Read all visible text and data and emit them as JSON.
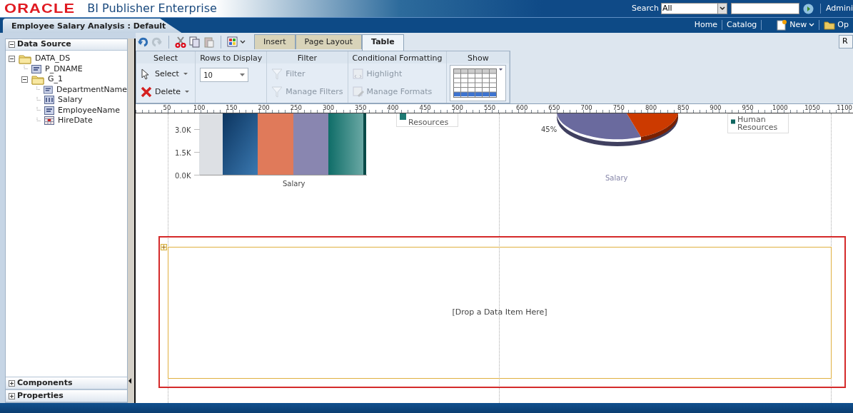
{
  "header": {
    "logo": "ORACLE",
    "product": "BI Publisher Enterprise",
    "search_label": "Search",
    "search_scope": "All",
    "user": "Admini"
  },
  "nav": {
    "report_tab": "Employee Salary Analysis : Default",
    "links": [
      {
        "label": "Home",
        "kind": "link"
      },
      {
        "label": "Catalog",
        "kind": "link"
      },
      {
        "label": "New",
        "kind": "new"
      },
      {
        "label": "Op",
        "kind": "open"
      }
    ]
  },
  "data_source": {
    "title": "Data Source",
    "expanded": true,
    "tree": [
      {
        "label": "DATA_DS",
        "kind": "folder",
        "expanded": true,
        "children": [
          {
            "label": "P_DNAME",
            "kind": "text"
          },
          {
            "label": "G_1",
            "kind": "folder",
            "expanded": true,
            "children": [
              {
                "label": "DepartmentName",
                "kind": "text"
              },
              {
                "label": "Salary",
                "kind": "number"
              },
              {
                "label": "EmployeeName",
                "kind": "text"
              },
              {
                "label": "HireDate",
                "kind": "date"
              }
            ]
          }
        ]
      }
    ]
  },
  "panels": [
    {
      "title": "Components",
      "expanded": false
    },
    {
      "title": "Properties",
      "expanded": false
    }
  ],
  "tabs": [
    {
      "label": "Insert",
      "selected": false
    },
    {
      "label": "Page Layout",
      "selected": false
    },
    {
      "label": "Table",
      "selected": true
    }
  ],
  "right_button": "R",
  "ribbon": [
    {
      "title": "Select",
      "kind": "buttons",
      "items": [
        {
          "label": "Select",
          "kind": "pointer",
          "disabled": false
        },
        {
          "label": "Delete",
          "kind": "delete",
          "disabled": false
        }
      ]
    },
    {
      "title": "Rows to Display",
      "kind": "select",
      "value": "10"
    },
    {
      "title": "Filter",
      "kind": "buttons",
      "items": [
        {
          "label": "Filter",
          "kind": "filter",
          "disabled": true
        },
        {
          "label": "Manage Filters",
          "kind": "filter",
          "disabled": true
        }
      ]
    },
    {
      "title": "Conditional Formatting",
      "kind": "buttons",
      "items": [
        {
          "label": "Highlight",
          "kind": "highlight",
          "disabled": true
        },
        {
          "label": "Manage Formats",
          "kind": "formats",
          "disabled": true
        }
      ]
    },
    {
      "title": "Show",
      "kind": "gallery"
    }
  ],
  "ruler": [
    "50",
    "100",
    "150",
    "200",
    "250",
    "300",
    "350",
    "400",
    "450",
    "500",
    "550",
    "600",
    "650",
    "700",
    "750",
    "800",
    "850",
    "900",
    "950",
    "1000",
    "1050",
    "1100"
  ],
  "canvas": {
    "bar_chart": {
      "yticks": [
        "3.0K",
        "1.5K",
        "0.0K"
      ],
      "xlabel": "Salary",
      "legend": "Resources"
    },
    "pie_chart": {
      "slice_label": "45%",
      "title": "Salary",
      "legend": "Human Resources"
    },
    "drop_zone": {
      "text": "[Drop a Data Item Here]",
      "selected": true
    }
  }
}
